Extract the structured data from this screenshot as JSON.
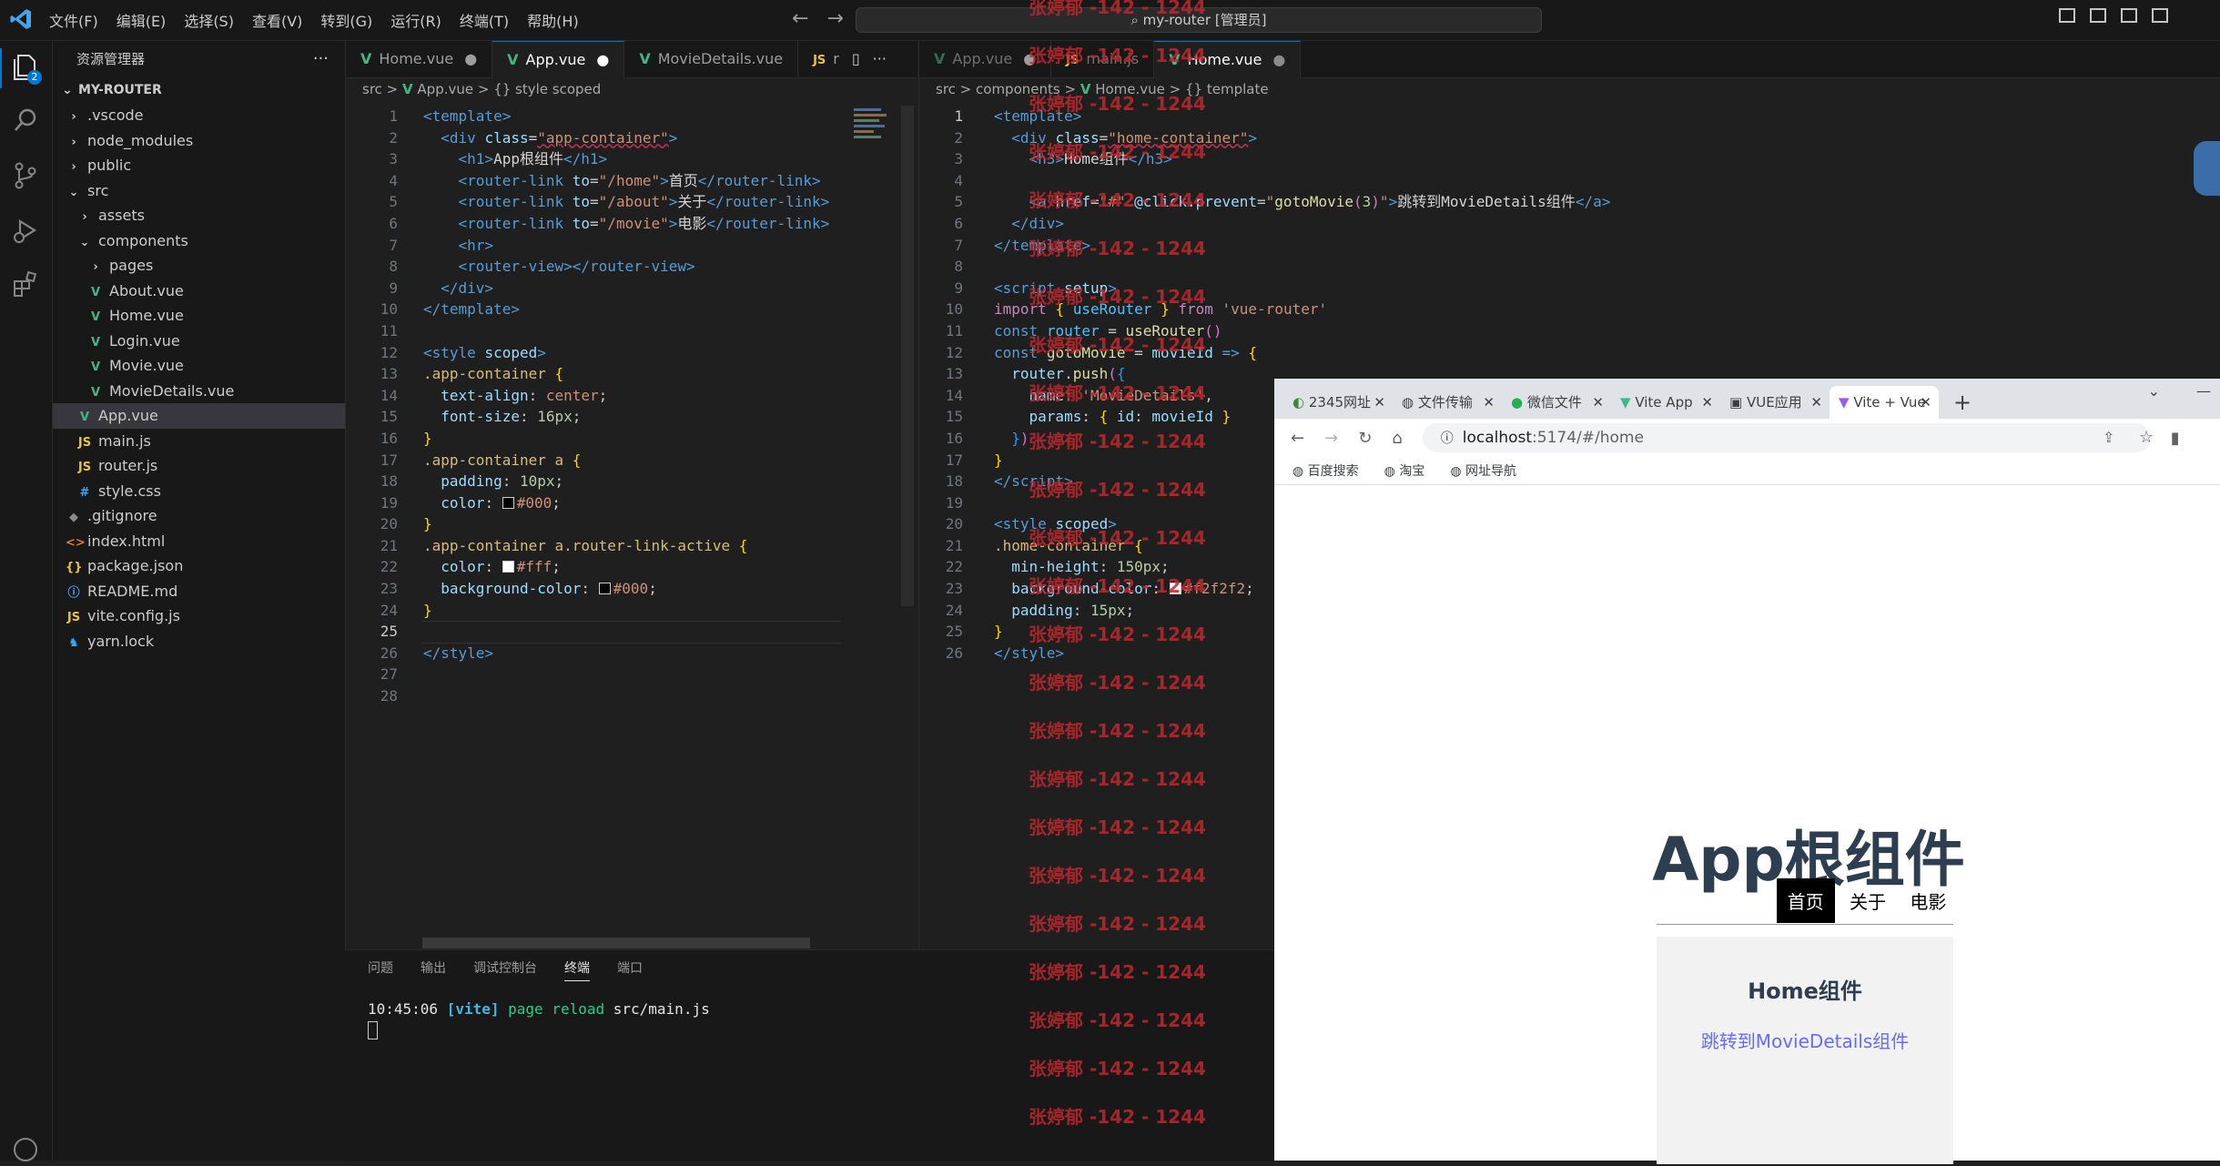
{
  "titlebar": {
    "menus": [
      "文件(F)",
      "编辑(E)",
      "选择(S)",
      "查看(V)",
      "转到(G)",
      "运行(R)",
      "终端(T)",
      "帮助(H)"
    ],
    "search": "my-router [管理员]"
  },
  "activity": {
    "badge": "2"
  },
  "explorer": {
    "title": "资源管理器",
    "root": "MY-ROUTER",
    "items": [
      {
        "label": ".vscode",
        "type": "folder",
        "depth": 1
      },
      {
        "label": "node_modules",
        "type": "folder",
        "depth": 1
      },
      {
        "label": "public",
        "type": "folder",
        "depth": 1
      },
      {
        "label": "src",
        "type": "folder-open",
        "depth": 1
      },
      {
        "label": "assets",
        "type": "folder",
        "depth": 2
      },
      {
        "label": "components",
        "type": "folder-open",
        "depth": 2
      },
      {
        "label": "pages",
        "type": "folder",
        "depth": 3
      },
      {
        "label": "About.vue",
        "type": "vue",
        "depth": 3
      },
      {
        "label": "Home.vue",
        "type": "vue",
        "depth": 3
      },
      {
        "label": "Login.vue",
        "type": "vue",
        "depth": 3
      },
      {
        "label": "Movie.vue",
        "type": "vue",
        "depth": 3
      },
      {
        "label": "MovieDetails.vue",
        "type": "vue",
        "depth": 3
      },
      {
        "label": "App.vue",
        "type": "vue",
        "depth": 2,
        "selected": true
      },
      {
        "label": "main.js",
        "type": "js",
        "depth": 2
      },
      {
        "label": "router.js",
        "type": "js",
        "depth": 2
      },
      {
        "label": "style.css",
        "type": "css",
        "depth": 2
      },
      {
        "label": ".gitignore",
        "type": "git",
        "depth": 1
      },
      {
        "label": "index.html",
        "type": "html",
        "depth": 1
      },
      {
        "label": "package.json",
        "type": "json",
        "depth": 1
      },
      {
        "label": "README.md",
        "type": "info",
        "depth": 1
      },
      {
        "label": "vite.config.js",
        "type": "js",
        "depth": 1
      },
      {
        "label": "yarn.lock",
        "type": "yarn",
        "depth": 1
      }
    ]
  },
  "editor_left": {
    "tabs": [
      "Home.vue",
      "App.vue",
      "MovieDetails.vue",
      "r"
    ],
    "breadcrumb": [
      "src",
      "App.vue",
      "{} style scoped"
    ],
    "active_line": "25"
  },
  "editor_right": {
    "tabs": [
      "App.vue",
      "main.js",
      "Home.vue"
    ],
    "breadcrumb": [
      "src",
      "components",
      "Home.vue",
      "{} template"
    ]
  },
  "panel": {
    "tabs": [
      "问题",
      "输出",
      "调试控制台",
      "终端",
      "端口"
    ],
    "log_time": "10:45:06",
    "log_tag": "[vite]",
    "log_msg": "page reload",
    "log_path": "src/main.js"
  },
  "browser": {
    "tabs": [
      "2345网址",
      "文件传输",
      "微信文件",
      "Vite App",
      "VUE应用",
      "Vite + Vue"
    ],
    "url_host": "localhost",
    "url_rest": ":5174/#/home",
    "bookmarks": [
      "百度搜索",
      "淘宝",
      "网址导航"
    ],
    "page": {
      "title": "App根组件",
      "nav": [
        "首页",
        "关于",
        "电影"
      ],
      "home_title": "Home组件",
      "link": "跳转到MovieDetails组件"
    }
  },
  "watermark": "张婷郁 -142 - 1244"
}
